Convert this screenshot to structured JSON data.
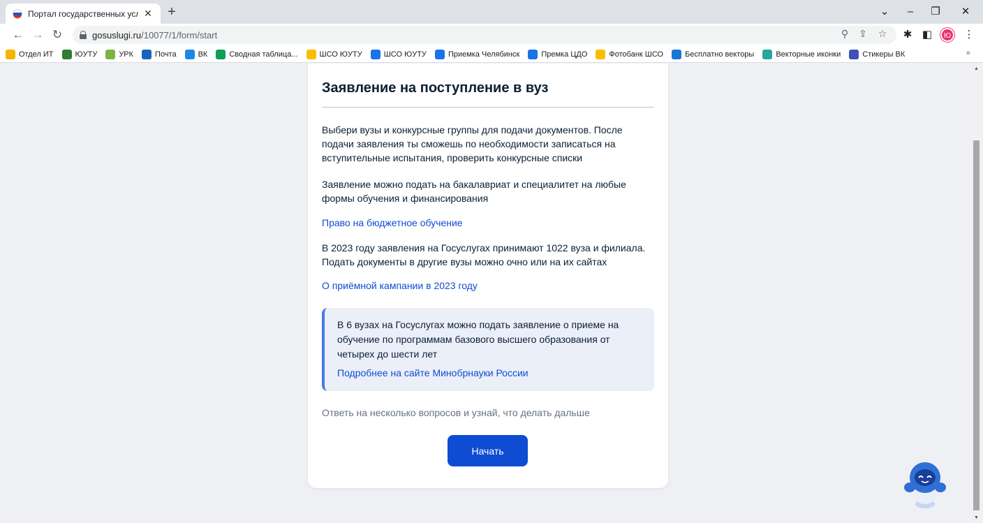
{
  "browser": {
    "tab_title": "Портал государственных услуг",
    "tab_close": "✕",
    "new_tab": "+",
    "window_controls": {
      "minimize": "–",
      "restore": "❐",
      "close": "✕",
      "tab_search": "⌄"
    },
    "url_host": "gosuslugi.ru",
    "url_path": "/10077/1/form/start",
    "bookmarks": [
      {
        "label": "Отдел ИТ",
        "icon": "folder-icon",
        "color": "#f4b400"
      },
      {
        "label": "ЮУТУ",
        "icon": "university-icon",
        "color": "#2e7d32"
      },
      {
        "label": "УРК",
        "icon": "leaf-icon",
        "color": "#7cb342"
      },
      {
        "label": "Почта",
        "icon": "mail-icon",
        "color": "#1565c0"
      },
      {
        "label": "ВК",
        "icon": "chat-icon",
        "color": "#1e88e5"
      },
      {
        "label": "Сводная таблица...",
        "icon": "sheets-icon",
        "color": "#0f9d58"
      },
      {
        "label": "ШСО ЮУТУ",
        "icon": "drive-icon",
        "color": "#fbbc04"
      },
      {
        "label": "ШСО ЮУТУ",
        "icon": "cloud-icon",
        "color": "#1a73e8"
      },
      {
        "label": "Приемка Челябинск",
        "icon": "cloud-icon",
        "color": "#1a73e8"
      },
      {
        "label": "Премка ЦДО",
        "icon": "cloud-icon",
        "color": "#1a73e8"
      },
      {
        "label": "Фотобанк ШСО",
        "icon": "drive-icon",
        "color": "#fbbc04"
      },
      {
        "label": "Бесплатно векторы",
        "icon": "vector-icon",
        "color": "#1976d2"
      },
      {
        "label": "Векторные иконки",
        "icon": "v-icon",
        "color": "#26a69a"
      },
      {
        "label": "Стикеры ВК",
        "icon": "vk-icon",
        "color": "#3f51b5"
      }
    ],
    "bookmarks_overflow": "»",
    "profile_initial": "Ю"
  },
  "card": {
    "title": "Заявление на поступление в вуз",
    "intro": "Выбери вузы и конкурсные группы для подачи документов. После подачи заявления ты сможешь по необходимости записаться на вступительные испытания, проверить конкурсные списки",
    "forms": "Заявление можно подать на бакалавриат и специалитет на любые формы обучения и финансирования",
    "budget_link": "Право на бюджетное обучение",
    "stats": "В 2023 году заявления на Госуслугах принимают 1022 вуза и филиала. Подать документы в другие вузы можно очно или на их сайтах",
    "campaign_link": "О приёмной кампании в 2023 году",
    "info_text": "В 6 вузах на Госуслугах можно подать заявление о приеме на обучение по программам базового высшего образования от четырех до шести лет",
    "info_link": "Подробнее на сайте Минобрнауки России",
    "hint": "Ответь на несколько вопросов и узнай, что делать дальше",
    "start_button": "Начать"
  },
  "colors": {
    "primary": "#0d4cd3",
    "text": "#0b1f33",
    "info_bg": "#ebeff8",
    "info_accent": "#4a79e3"
  }
}
